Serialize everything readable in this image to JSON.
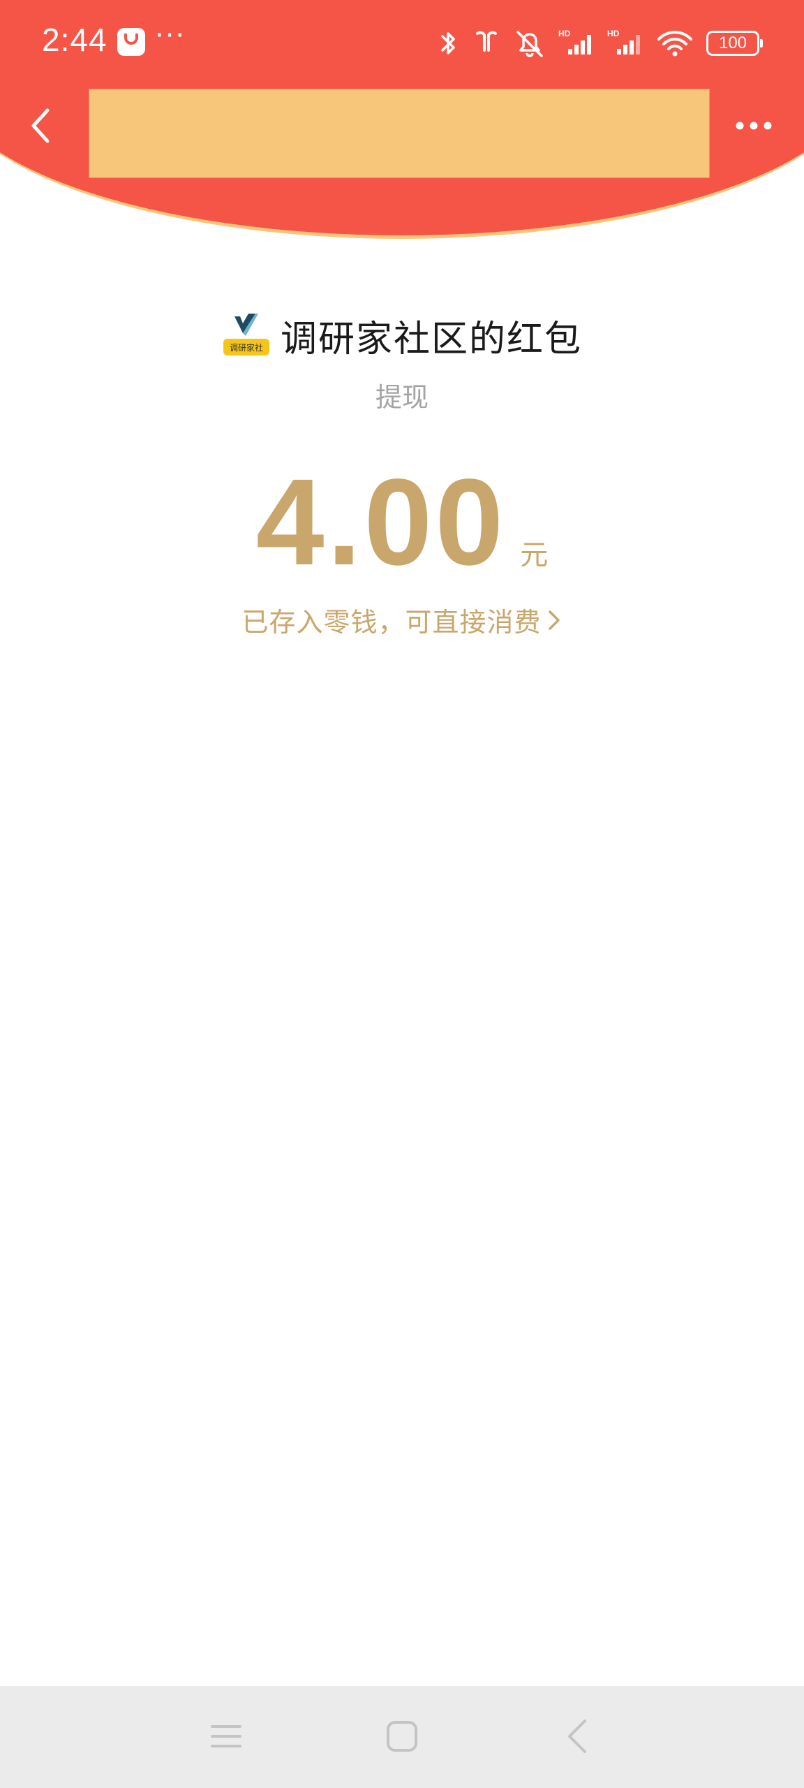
{
  "status_bar": {
    "time": "2:44",
    "more": "···",
    "battery": "100",
    "icons": [
      "bluetooth-icon",
      "earbuds-icon",
      "bell-muted-icon",
      "signal-hd-icon",
      "signal-hd-icon",
      "wifi-icon",
      "battery-icon"
    ],
    "signal_label": "HD"
  },
  "nav": {
    "back_icon": "chevron-left-icon",
    "more_icon": "more-dots-icon"
  },
  "red_packet": {
    "sender": "调研家社区的红包",
    "logo_text": "调研家社",
    "subtitle": "提现",
    "amount": "4.00",
    "unit": "元",
    "deposit_text": "已存入零钱，可直接消费"
  },
  "system_nav": {
    "icons": [
      "menu-icon",
      "home-icon",
      "back-icon"
    ]
  },
  "colors": {
    "header_red": "#f55547",
    "arc_border": "#f7c67a",
    "gold": "#c9a66b",
    "subtitle_gray": "#a3a3a3"
  }
}
